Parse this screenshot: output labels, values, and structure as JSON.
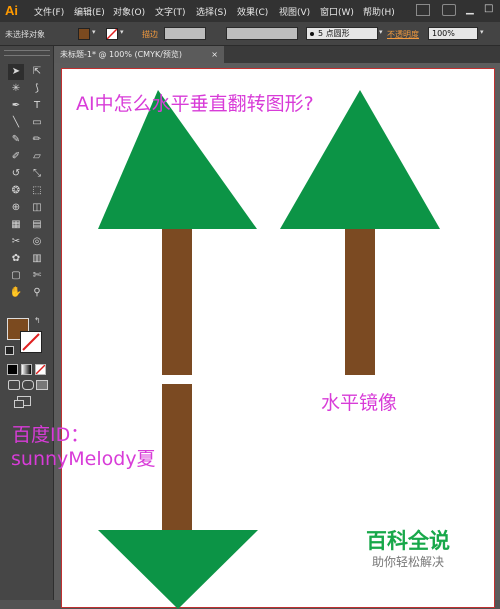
{
  "app": {
    "logo": "Ai"
  },
  "menu": [
    "文件(F)",
    "编辑(E)",
    "对象(O)",
    "文字(T)",
    "选择(S)",
    "效果(C)",
    "视图(V)",
    "窗口(W)",
    "帮助(H)"
  ],
  "control_bar": {
    "selection_label": "未选择对象",
    "stroke_label": "描边",
    "brush_size": "5",
    "brush_shape": "点圆形",
    "opacity_label": "不透明度",
    "opacity_value": "100%"
  },
  "document_tab": {
    "label": "未标题-1* @ 100% (CMYK/预览)",
    "close": "×"
  },
  "colors": {
    "fill": "#7b4a1f",
    "triangle": "#0c9446",
    "trunk": "#7b4a22",
    "annotation_magenta": "#d83cd8",
    "brand_green": "#18a84a"
  },
  "canvas": {
    "title": "AI中怎么水平垂直翻转图形?",
    "mirror_label": "水平镜像",
    "credit_line1": "百度ID：",
    "credit_line2": "sunnyMelody夏",
    "brand": "百科全说",
    "brand_sub": "助你轻松解决"
  },
  "tools": [
    "selection-tool",
    "direct-selection-tool",
    "magic-wand-tool",
    "lasso-tool",
    "pen-tool",
    "type-tool",
    "line-tool",
    "rectangle-tool",
    "paintbrush-tool",
    "pencil-tool",
    "blob-brush-tool",
    "eraser-tool",
    "rotate-tool",
    "scale-tool",
    "warp-tool",
    "free-transform-tool",
    "shape-builder-tool",
    "perspective-tool",
    "mesh-tool",
    "gradient-tool",
    "eyedropper-tool",
    "blend-tool",
    "symbol-sprayer-tool",
    "graph-tool",
    "artboard-tool",
    "slice-tool",
    "hand-tool",
    "zoom-tool"
  ]
}
